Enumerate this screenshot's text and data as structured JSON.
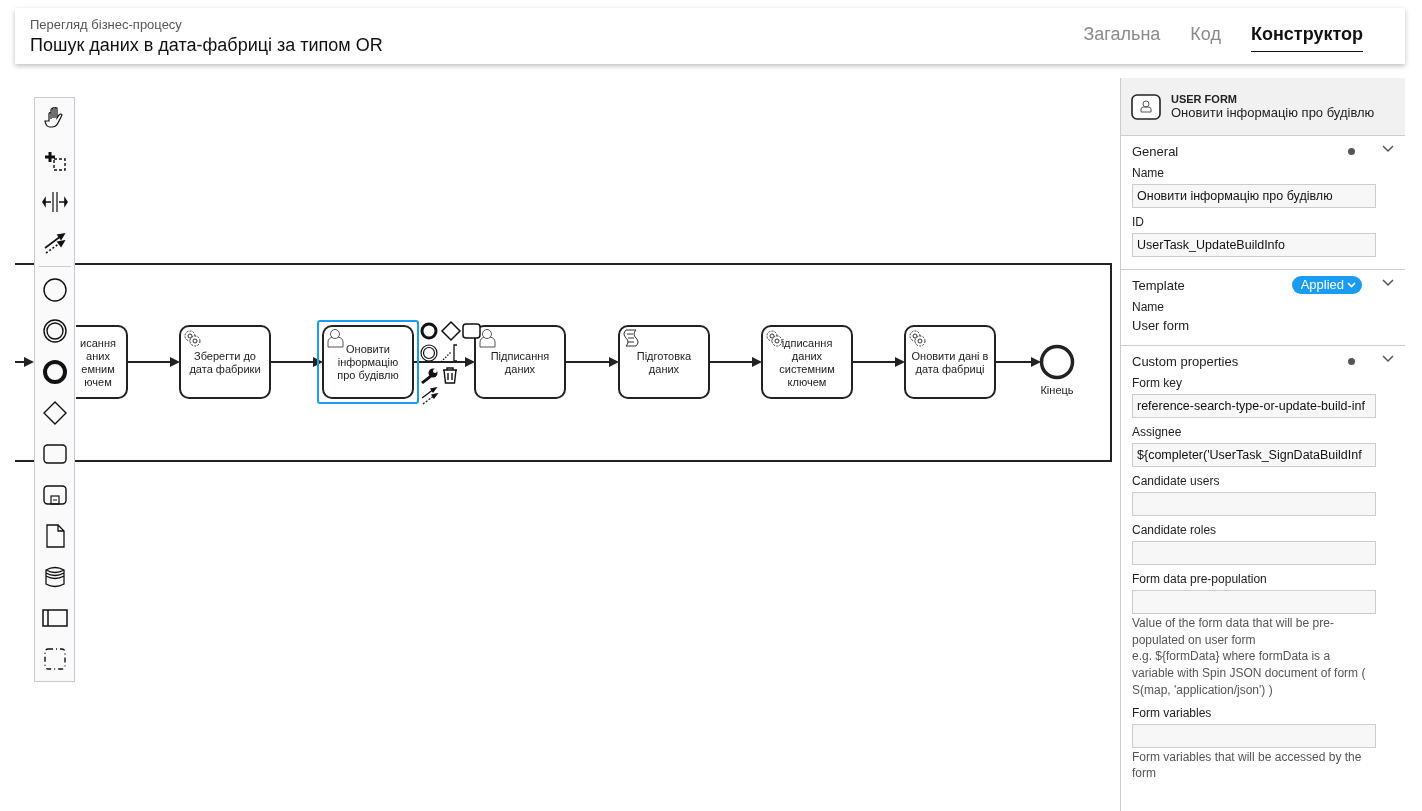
{
  "header": {
    "subtitle": "Перегляд бізнес-процесу",
    "title": "Пошук даних в дата-фабриці за типом OR"
  },
  "tabs": [
    {
      "label": "Загальна",
      "selected": false
    },
    {
      "label": "Код",
      "selected": false
    },
    {
      "label": "Конструктор",
      "selected": true
    }
  ],
  "diagram": {
    "tasks": [
      {
        "kind": "plain",
        "lines": [
          "исання",
          "аних",
          "емним",
          "ючем"
        ],
        "selected": false
      },
      {
        "kind": "service",
        "lines": [
          "Зберегти до",
          "дата фабрики"
        ],
        "selected": false
      },
      {
        "kind": "user",
        "lines": [
          "Оновити",
          "інформацію",
          "про будівлю"
        ],
        "selected": true
      },
      {
        "kind": "user",
        "lines": [
          "Підписання",
          "даних"
        ],
        "selected": false
      },
      {
        "kind": "script",
        "lines": [
          "Підготовка",
          "даних"
        ],
        "selected": false
      },
      {
        "kind": "service",
        "lines": [
          "ідписання",
          "даних",
          "системним",
          "ключем"
        ],
        "selected": false
      },
      {
        "kind": "service",
        "lines": [
          "Оновити дані в",
          "дата фабриці"
        ],
        "selected": false
      }
    ],
    "end_event": {
      "label": "Кінець"
    }
  },
  "panel": {
    "element_type": "USER FORM",
    "element_name": "Оновити інформацію про будівлю",
    "sections": [
      {
        "title": "General",
        "has_values": true,
        "expanded": true,
        "fields": [
          {
            "kind": "input",
            "label": "Name",
            "value": "Оновити інформацію про будівлю"
          },
          {
            "kind": "input",
            "label": "ID",
            "value": "UserTask_UpdateBuildInfo"
          }
        ]
      },
      {
        "title": "Template",
        "badge": "Applied",
        "has_values": false,
        "expanded": true,
        "fields": [
          {
            "kind": "text",
            "label": "Name",
            "value": "User form"
          }
        ]
      },
      {
        "title": "Custom properties",
        "has_values": true,
        "expanded": true,
        "fields": [
          {
            "kind": "input",
            "label": "Form key",
            "value": "reference-search-type-or-update-build-inf"
          },
          {
            "kind": "input",
            "label": "Assignee",
            "value": "${completer('UserTask_SignDataBuildInf"
          },
          {
            "kind": "input",
            "label": "Candidate users"
          },
          {
            "kind": "input",
            "label": "Candidate roles"
          },
          {
            "kind": "input",
            "label": "Form data pre-population",
            "descriptions": [
              "Value of the form data that will be pre-populated on user form",
              "e.g. ${formData} where formData is a variable with Spin JSON document of form ( S(map, 'application/json') )"
            ]
          },
          {
            "kind": "input",
            "label": "Form variables",
            "descriptions": [
              "Form variables that will be accessed by the form"
            ]
          }
        ]
      }
    ]
  }
}
